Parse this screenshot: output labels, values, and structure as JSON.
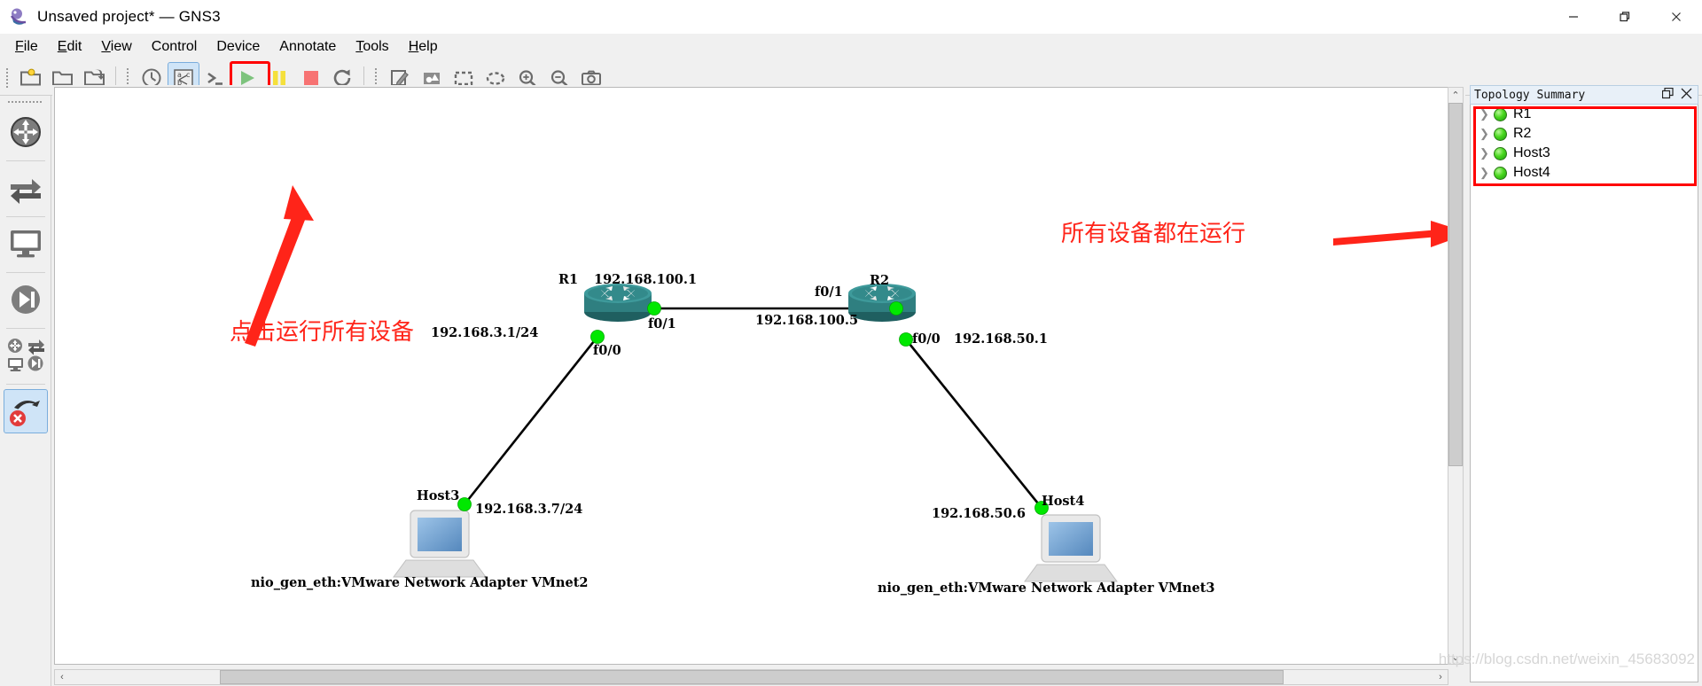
{
  "window": {
    "title": "Unsaved project* — GNS3",
    "app_icon": "gns3-logo-icon",
    "minimize": "−",
    "maximize": "❐",
    "close": "✕"
  },
  "menubar": {
    "items": [
      {
        "label": "File",
        "mnemonic": "F"
      },
      {
        "label": "Edit",
        "mnemonic": "E"
      },
      {
        "label": "View",
        "mnemonic": "V"
      },
      {
        "label": "Control",
        "mnemonic": "C"
      },
      {
        "label": "Device",
        "mnemonic": "D"
      },
      {
        "label": "Annotate",
        "mnemonic": "A"
      },
      {
        "label": "Tools",
        "mnemonic": "T"
      },
      {
        "label": "Help",
        "mnemonic": "H"
      }
    ]
  },
  "toolbar": {
    "groups": [
      {
        "buttons": [
          {
            "name": "new-project-button",
            "icon": "folder-new-icon"
          },
          {
            "name": "open-project-button",
            "icon": "folder-open-icon"
          },
          {
            "name": "save-project-as-button",
            "icon": "folder-save-icon"
          }
        ]
      },
      {
        "buttons": [
          {
            "name": "snapshot-button",
            "icon": "clock-icon"
          },
          {
            "name": "show-hide-interface-labels-button",
            "icon": "abc-labels-icon",
            "state": "checked"
          },
          {
            "name": "console-to-all-devices-button",
            "icon": "console-prompt-icon"
          },
          {
            "name": "start-all-devices-button",
            "icon": "play-triangle-icon",
            "state": "highlighted"
          },
          {
            "name": "suspend-all-devices-button",
            "icon": "pause-bars-icon"
          },
          {
            "name": "stop-all-devices-button",
            "icon": "stop-square-icon"
          },
          {
            "name": "reload-all-devices-button",
            "icon": "reload-circular-arrow-icon"
          }
        ]
      },
      {
        "buttons": [
          {
            "name": "add-note-button",
            "icon": "note-pencil-icon"
          },
          {
            "name": "insert-image-button",
            "icon": "image-shapes-icon"
          },
          {
            "name": "draw-rectangle-button",
            "icon": "dashed-rectangle-icon"
          },
          {
            "name": "draw-ellipse-button",
            "icon": "dashed-ellipse-icon"
          },
          {
            "name": "zoom-in-button",
            "icon": "zoom-in-magnifier-icon"
          },
          {
            "name": "zoom-out-button",
            "icon": "zoom-out-magnifier-icon"
          },
          {
            "name": "screenshot-button",
            "icon": "camera-icon"
          }
        ]
      }
    ]
  },
  "left_dock": {
    "items": [
      {
        "name": "browse-routers-button",
        "icon": "router-icon"
      },
      {
        "name": "browse-switches-button",
        "icon": "switch-arrows-icon"
      },
      {
        "name": "browse-end-devices-button",
        "icon": "monitor-icon"
      },
      {
        "name": "browse-all-devices-button",
        "icon": "all-devices-icon"
      },
      {
        "name": "add-link-button",
        "icon": "link-cable-icon",
        "state": "selected"
      }
    ]
  },
  "topology_summary": {
    "title": "Topology Summary",
    "float_icon": "float-dock-icon",
    "close_icon": "close-icon",
    "nodes": [
      {
        "name": "R1",
        "status": "running"
      },
      {
        "name": "R2",
        "status": "running"
      },
      {
        "name": "Host3",
        "status": "running"
      },
      {
        "name": "Host4",
        "status": "running"
      }
    ]
  },
  "topology": {
    "nodes": [
      {
        "id": "R1",
        "type": "router",
        "label": "R1",
        "extra_label": "192.168.100.1"
      },
      {
        "id": "R2",
        "type": "router",
        "label": "R2"
      },
      {
        "id": "Host3",
        "type": "host",
        "label": "Host3",
        "caption": "nio_gen_eth:VMware Network Adapter VMnet2"
      },
      {
        "id": "Host4",
        "type": "host",
        "label": "Host4",
        "caption": "nio_gen_eth:VMware Network Adapter VMnet3"
      }
    ],
    "interface_labels": [
      {
        "text": "f0/1",
        "node": "R1",
        "port": "f0/1"
      },
      {
        "text": "f0/0",
        "node": "R1",
        "port": "f0/0"
      },
      {
        "text": "f0/1",
        "node": "R2",
        "port": "f0/1"
      },
      {
        "text": "f0/0",
        "node": "R2",
        "port": "f0/0"
      }
    ],
    "ip_labels": [
      {
        "text": "192.168.100.1",
        "near": "R1"
      },
      {
        "text": "192.168.3.1/24",
        "near": "R1-f0/0"
      },
      {
        "text": "192.168.100.5",
        "near": "R1-R2-link"
      },
      {
        "text": "192.168.50.1",
        "near": "R2-f0/0"
      },
      {
        "text": "192.168.3.7/24",
        "near": "Host3"
      },
      {
        "text": "192.168.50.6",
        "near": "Host4"
      }
    ]
  },
  "annotations": [
    {
      "name": "annotation-click-start-all",
      "text": "点击运行所有设备",
      "color": "#ff2419"
    },
    {
      "name": "annotation-all-devices-running",
      "text": "所有设备都在运行",
      "color": "#ff2419"
    }
  ],
  "watermark": {
    "text": "https://blog.csdn.net/weixin_45683092"
  },
  "colors": {
    "highlight_red": "#ff0000",
    "annotation_red": "#ff2419",
    "router_teal": "#2f7f80",
    "led_green": "#49d81e",
    "toolbar_bg": "#f0f0f0",
    "canvas_bg": "#ffffff"
  }
}
